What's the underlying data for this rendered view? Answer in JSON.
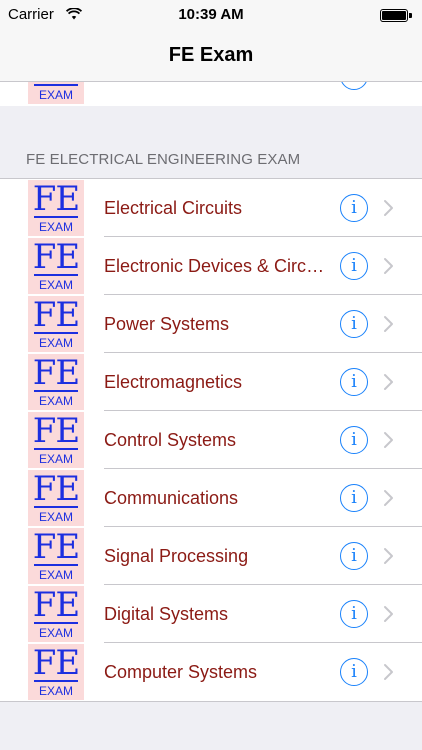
{
  "status_bar": {
    "carrier": "Carrier",
    "time": "10:39 AM",
    "wifi_icon": "wifi-icon",
    "battery_icon": "battery-icon"
  },
  "nav": {
    "title": "FE Exam"
  },
  "logo": {
    "main": "FE",
    "sub": "EXAM",
    "bg_color": "#fbdada",
    "text_color": "#1c2fe0"
  },
  "section": {
    "header": "FE ELECTRICAL ENGINEERING EXAM",
    "items": [
      {
        "label": "Electrical Circuits"
      },
      {
        "label": "Electronic Devices & Circuits"
      },
      {
        "label": "Power Systems"
      },
      {
        "label": "Electromagnetics"
      },
      {
        "label": "Control Systems"
      },
      {
        "label": "Communications"
      },
      {
        "label": "Signal Processing"
      },
      {
        "label": "Digital Systems"
      },
      {
        "label": "Computer Systems"
      }
    ]
  },
  "icons": {
    "info": "i",
    "accent": "#1a82fb",
    "label_color": "#8b1a14"
  }
}
